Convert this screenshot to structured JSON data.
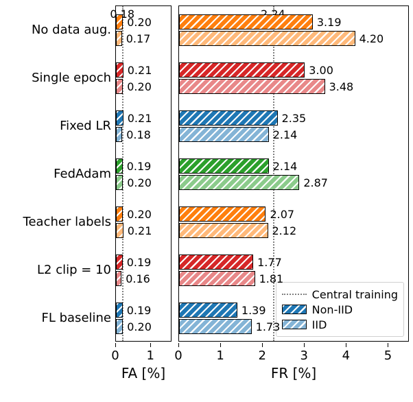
{
  "chart_data": {
    "type": "bar",
    "orientation": "horizontal",
    "panels": [
      {
        "id": "fa",
        "xlabel": "FA [%]",
        "xlim": [
          0,
          1.6
        ],
        "ticks": [
          0,
          1
        ],
        "ref": 0.18
      },
      {
        "id": "fr",
        "xlabel": "FR [%]",
        "xlim": [
          0,
          5.5
        ],
        "ticks": [
          0,
          1,
          2,
          3,
          4,
          5
        ],
        "ref": 2.24
      }
    ],
    "categories": [
      "No data aug.",
      "Single epoch",
      "Fixed LR",
      "FedAdam",
      "Teacher labels",
      "L2 clip = 10",
      "FL baseline"
    ],
    "series_names": [
      "Non-IID",
      "IID"
    ],
    "groups": [
      {
        "label": "No data aug.",
        "color": "#ff7f0e",
        "noniid": {
          "fa": 0.2,
          "fr": 3.19
        },
        "iid": {
          "fa": 0.17,
          "fr": 4.2
        }
      },
      {
        "label": "Single epoch",
        "color": "#d62728",
        "noniid": {
          "fa": 0.21,
          "fr": 3.0
        },
        "iid": {
          "fa": 0.2,
          "fr": 3.48
        }
      },
      {
        "label": "Fixed LR",
        "color": "#1f77b4",
        "noniid": {
          "fa": 0.21,
          "fr": 2.35
        },
        "iid": {
          "fa": 0.18,
          "fr": 2.14
        }
      },
      {
        "label": "FedAdam",
        "color": "#2ca02c",
        "noniid": {
          "fa": 0.19,
          "fr": 2.14
        },
        "iid": {
          "fa": 0.2,
          "fr": 2.87
        }
      },
      {
        "label": "Teacher labels",
        "color": "#ff7f0e",
        "noniid": {
          "fa": 0.2,
          "fr": 2.07
        },
        "iid": {
          "fa": 0.21,
          "fr": 2.12
        }
      },
      {
        "label": "L2 clip = 10",
        "color": "#d62728",
        "noniid": {
          "fa": 0.19,
          "fr": 1.77
        },
        "iid": {
          "fa": 0.16,
          "fr": 1.81
        }
      },
      {
        "label": "FL baseline",
        "color": "#1f77b4",
        "noniid": {
          "fa": 0.19,
          "fr": 1.39
        },
        "iid": {
          "fa": 0.2,
          "fr": 1.73
        }
      }
    ],
    "legend": {
      "central": "Central training",
      "noniid": "Non-IID",
      "iid": "IID",
      "swatch_color": "#1f77b4"
    },
    "ref_labels": {
      "fa": "0.18",
      "fr": "2.24"
    }
  }
}
